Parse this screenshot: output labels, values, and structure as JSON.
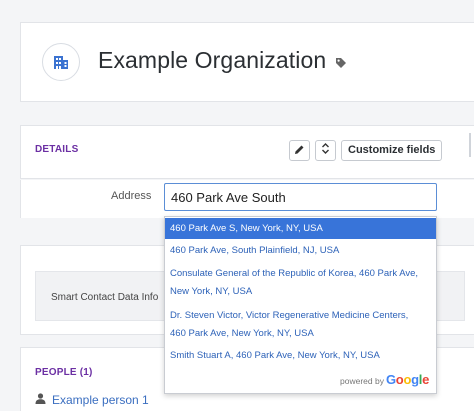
{
  "organization": {
    "title": "Example Organization"
  },
  "details": {
    "section_title": "DETAILS",
    "customize_label": "Customize fields",
    "address_label": "Address",
    "address_value": "460 Park Ave South"
  },
  "smart_contact": {
    "text": "Smart Contact Data Info"
  },
  "people": {
    "section_title": "PEOPLE (1)",
    "items": [
      {
        "name": "Example person 1"
      }
    ]
  },
  "suggestions": {
    "items": [
      {
        "text": "460 Park Ave S, New York, NY, USA"
      },
      {
        "text": "460 Park Ave, South Plainfield, NJ, USA"
      },
      {
        "line1": "Consulate General of the Republic of Korea, 460 Park Ave,",
        "line2": "New York, NY, USA"
      },
      {
        "line1": "Dr. Steven Victor, Victor Regenerative Medicine Centers,",
        "line2": "460 Park Ave, New York, NY, USA"
      },
      {
        "text": "Smith Stuart A, 460 Park Ave, New York, NY, USA"
      }
    ],
    "powered_by": "powered by",
    "google_letters": [
      "G",
      "o",
      "o",
      "g",
      "l",
      "e"
    ]
  },
  "colors": {
    "accent": "#6b2fa3",
    "link": "#2d62b8",
    "highlight": "#3874d9"
  }
}
